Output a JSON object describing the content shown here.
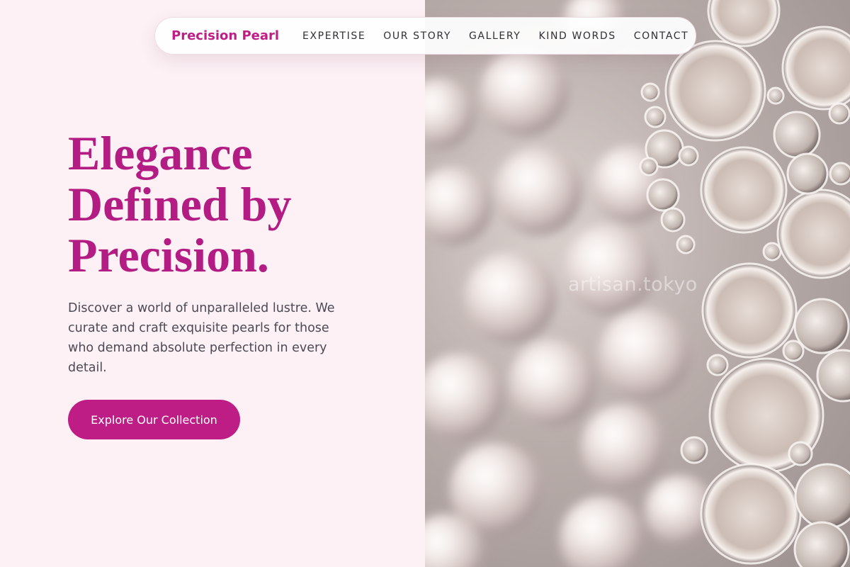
{
  "brand": {
    "name": "Precision Pearl",
    "color": "#be1e85"
  },
  "nav": {
    "links": [
      "EXPERTISE",
      "OUR STORY",
      "GALLERY",
      "KIND WORDS",
      "CONTACT"
    ]
  },
  "hero": {
    "headline_lines": [
      "Elegance",
      "Defined by",
      "Precision."
    ],
    "description": "Discover a world of unparalleled lustre. We curate and craft exquisite pearls for those who demand absolute perfection in every detail.",
    "cta_label": "Explore Our Collection",
    "accent_color": "#bf1d86",
    "background_color": "#fdf1f5"
  },
  "image": {
    "subject": "pearls and water bubbles photo",
    "watermark": "artisan.tokyo"
  }
}
